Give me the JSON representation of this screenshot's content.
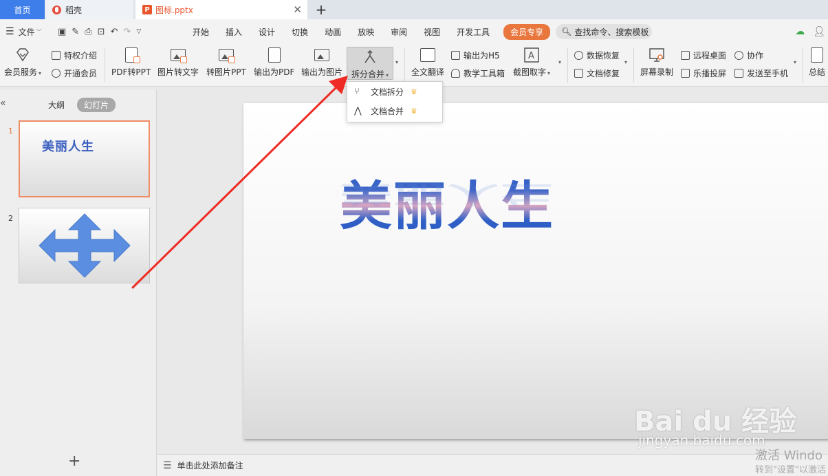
{
  "tabs": {
    "home": "首页",
    "daoke": "稻壳",
    "doc": "图标.pptx"
  },
  "menubar": {
    "file": "文件",
    "items": [
      "开始",
      "插入",
      "设计",
      "切换",
      "动画",
      "放映",
      "审阅",
      "视图",
      "开发工具"
    ],
    "vip": "会员专享",
    "search": "查找命令、搜索模板"
  },
  "ribbon": {
    "member_services": "会员服务",
    "privilege_intro": "特权介绍",
    "open_member": "开通会员",
    "pdf_to_ppt": "PDF转PPT",
    "image_to_text": "图片转文字",
    "to_image_ppt": "转图片PPT",
    "export_pdf": "输出为PDF",
    "export_image": "输出为图片",
    "split_merge": "拆分合并",
    "full_translate": "全文翻译",
    "export_h5": "输出为H5",
    "teaching_toolbox": "教学工具箱",
    "screenshot_text": "截图取字",
    "data_recovery": "数据恢复",
    "doc_repair": "文档修复",
    "screen_record": "屏幕录制",
    "remote_desktop": "远程桌面",
    "collaborate": "协作",
    "easy_cast": "乐播投屏",
    "send_to_phone": "发送至手机",
    "summary": "总结"
  },
  "dropdown": {
    "split": "文档拆分",
    "merge": "文档合并"
  },
  "leftpanel": {
    "outline": "大纲",
    "slides": "幻灯片",
    "slide1_num": "1",
    "slide1_title": "美丽人生",
    "slide2_num": "2"
  },
  "slide": {
    "title": "美丽人生"
  },
  "notes": {
    "placeholder": "单击此处添加备注"
  },
  "watermark": {
    "baidu": "Bai du 经验",
    "site": "jingyan.baidu.com",
    "activate": "激活 Windo",
    "activate_hint": "转到\"设置\"以激活"
  },
  "colors": {
    "home_tab": "#3d7eea",
    "vip": "#e8763d",
    "accent_orange": "#e8542c",
    "arrow": "#ee2b24",
    "title_blue": "#2b5bc4",
    "shape_blue": "#5b8ee0"
  }
}
